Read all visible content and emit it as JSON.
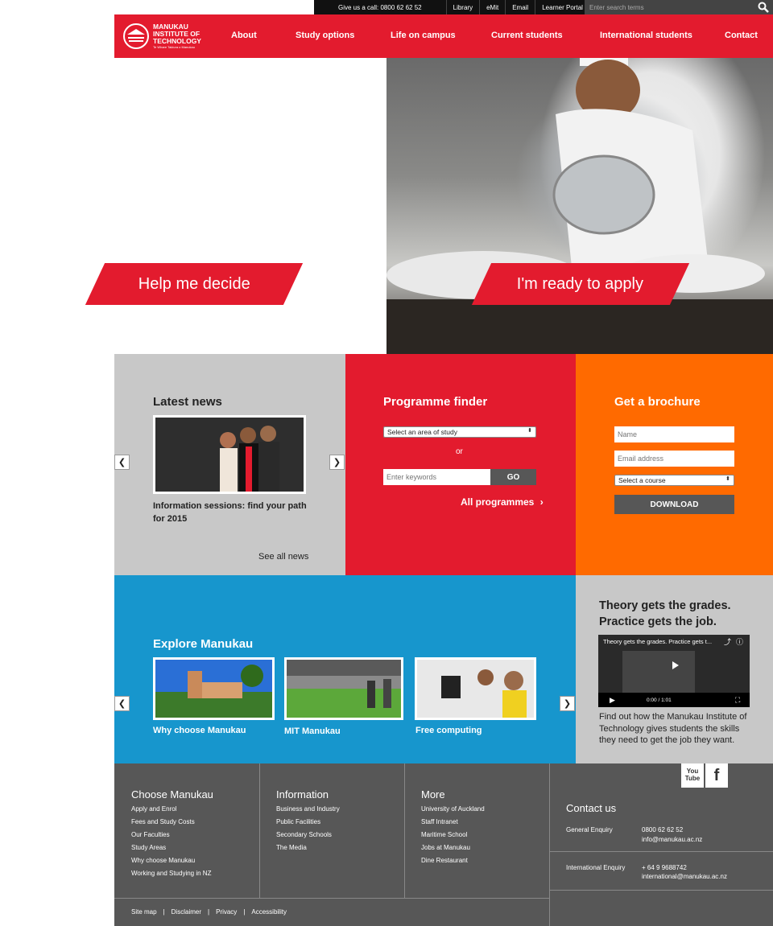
{
  "topbar": {
    "call": "Give us a call: 0800 62 62 52",
    "links": [
      "Library",
      "eMit",
      "Email",
      "Learner Portal"
    ],
    "search_placeholder": "Enter search terms"
  },
  "logo": {
    "line1": "MANUKAU",
    "line2": "INSTITUTE OF",
    "line3": "TECHNOLOGY",
    "tagline": "Te Whare Takiura o Manukau"
  },
  "nav": [
    "About",
    "Study options",
    "Life on campus",
    "Current students",
    "International students",
    "Contact"
  ],
  "hero": {
    "left_button": "Help me decide",
    "right_button": "I'm ready to apply"
  },
  "news": {
    "title": "Latest news",
    "caption": "Information sessions: find your path for 2015",
    "see_all": "See all news"
  },
  "finder": {
    "title": "Programme finder",
    "select": "Select an area of study",
    "or": "or",
    "keywords_placeholder": "Enter keywords",
    "go": "GO",
    "all": "All programmes"
  },
  "brochure": {
    "title": "Get a brochure",
    "name_placeholder": "Name",
    "email_placeholder": "Email address",
    "course_select": "Select a course",
    "download": "DOWNLOAD"
  },
  "explore": {
    "title": "Explore Manukau",
    "items": [
      "Why choose Manukau",
      "MIT Manukau",
      "Free computing"
    ]
  },
  "video": {
    "heading1": "Theory gets the grades.",
    "heading2": "Practice gets the job.",
    "video_title": "Theory gets the grades. Practice gets t...",
    "time": "0:00 / 1:01",
    "description": "Find out how the Manukau Institute of Technology gives students the skills they need to get the job they want."
  },
  "footer": {
    "col1": {
      "title": "Choose Manukau",
      "links": [
        "Apply and Enrol",
        "Fees and Study Costs",
        "Our Faculties",
        "Study Areas",
        "Why choose Manukau",
        "Working and Studying in NZ"
      ]
    },
    "col2": {
      "title": "Information",
      "links": [
        "Business and Industry",
        "Public Facilities",
        "Secondary Schools",
        "The Media"
      ]
    },
    "col3": {
      "title": "More",
      "links": [
        "University of Auckland",
        "Staff Intranet",
        "Maritime School",
        "Jobs at Manukau",
        "Dine Restaurant"
      ]
    },
    "contact": {
      "title": "Contact us",
      "general_label": "General Enquiry",
      "general_phone": "0800 62 62 52",
      "general_email": "info@manukau.ac.nz",
      "intl_label": "International Enquiry",
      "intl_phone": "+ 64 9 9688742",
      "intl_email": "international@manukau.ac.nz"
    },
    "social": {
      "youtube": "You Tube",
      "facebook": "f"
    },
    "bottom_links": [
      "Site map",
      "Disclaimer",
      "Privacy",
      "Accessibility"
    ],
    "separator": "|"
  },
  "colors": {
    "red": "#e31b2e",
    "orange": "#ff6a00",
    "blue": "#1796cd",
    "grey": "#c8c8c8",
    "dark": "#575757"
  }
}
